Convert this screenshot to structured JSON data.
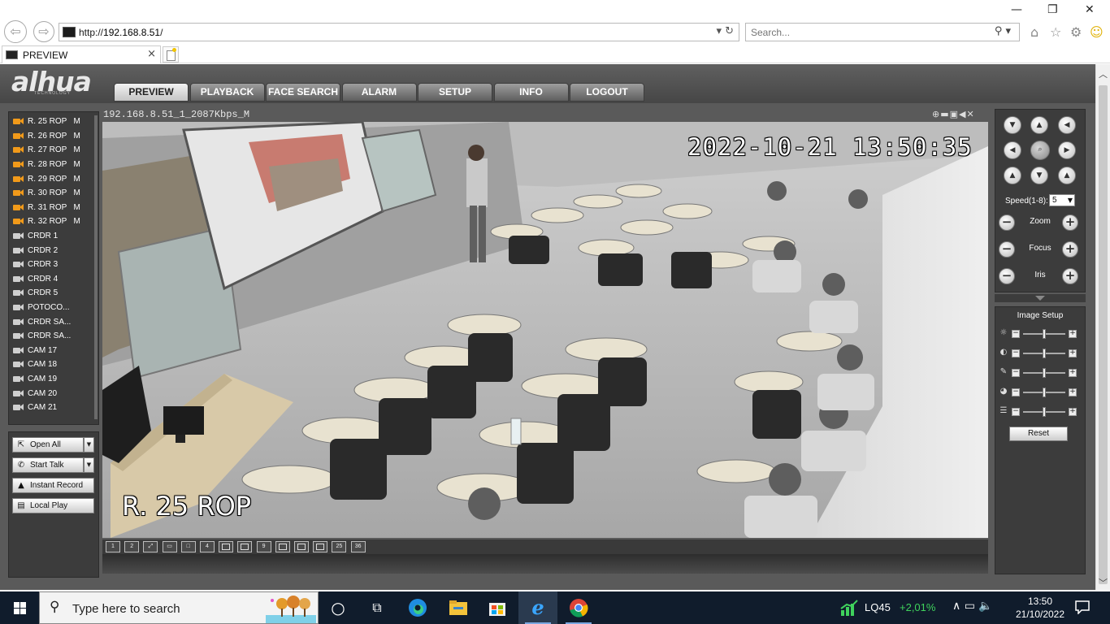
{
  "browser": {
    "back_icon": "back-arrow-icon",
    "forward_icon": "forward-arrow-icon",
    "url_prefix": "http://",
    "url_host": "192.168.8.51",
    "url_suffix": "/",
    "addr_controls": "▾ ↻",
    "search_placeholder": "Search...",
    "search_controls": "⚲ ▾",
    "tab_title": "PREVIEW",
    "tab_close": "×",
    "win_minimize": "—",
    "win_restore": "❐",
    "win_close": "✕",
    "home_glyph": "⌂",
    "fav_glyph": "☆",
    "gear_glyph": "⚙",
    "smiley_glyph": "☺"
  },
  "app": {
    "logo_text": "alhua",
    "logo_sub": "TECHNOLOGY",
    "nav": [
      {
        "label": "PREVIEW",
        "active": true
      },
      {
        "label": "PLAYBACK",
        "active": false
      },
      {
        "label": "FACE SEARCH",
        "active": false
      },
      {
        "label": "ALARM",
        "active": false
      },
      {
        "label": "SETUP",
        "active": false
      },
      {
        "label": "INFO",
        "active": false
      },
      {
        "label": "LOGOUT",
        "active": false
      }
    ]
  },
  "cameras": [
    {
      "name": "R. 25 ROP   M",
      "on": true
    },
    {
      "name": "R. 26 ROP   M",
      "on": true
    },
    {
      "name": "R. 27 ROP   M",
      "on": true
    },
    {
      "name": "R. 28 ROP   M",
      "on": true
    },
    {
      "name": "R. 29 ROP   M",
      "on": true
    },
    {
      "name": "R. 30 ROP   M",
      "on": true
    },
    {
      "name": "R. 31 ROP   M",
      "on": true
    },
    {
      "name": "R. 32 ROP   M",
      "on": true
    },
    {
      "name": "CRDR 1",
      "on": false
    },
    {
      "name": "CRDR 2",
      "on": false
    },
    {
      "name": "CRDR 3",
      "on": false
    },
    {
      "name": "CRDR 4",
      "on": false
    },
    {
      "name": "CRDR 5",
      "on": false
    },
    {
      "name": "POTOCO...",
      "on": false
    },
    {
      "name": "CRDR SA...",
      "on": false
    },
    {
      "name": "CRDR SA...",
      "on": false
    },
    {
      "name": "CAM 17",
      "on": false
    },
    {
      "name": "CAM 18",
      "on": false
    },
    {
      "name": "CAM 19",
      "on": false
    },
    {
      "name": "CAM 20",
      "on": false
    },
    {
      "name": "CAM 21",
      "on": false
    }
  ],
  "actions": {
    "open_all": "Open All",
    "start_talk": "Start Talk",
    "instant_record": "Instant Record",
    "local_play": "Local Play",
    "dropdown_glyph": "▼"
  },
  "video": {
    "stream_title": "192.168.8.51_1_2087Kbps_M",
    "window_icons": "⊕▬▣◀✕",
    "timestamp": "2022-10-21  13:50:35",
    "camera_label": "R. 25 ROP"
  },
  "layouts": [
    "1",
    "2",
    "⤢",
    "▭",
    "□",
    "4",
    "",
    "",
    "9",
    "",
    "",
    "",
    "25",
    "36"
  ],
  "ptz": {
    "speed_label": "Speed(1-8):",
    "speed_value": "5",
    "zoom_label": "Zoom",
    "focus_label": "Focus",
    "iris_label": "Iris",
    "minus": "−",
    "plus": "+"
  },
  "image_setup": {
    "title": "Image Setup",
    "reset_label": "Reset",
    "sliders": [
      {
        "icon": "brightness-icon",
        "glyph": "☼",
        "level": 0.5
      },
      {
        "icon": "contrast-icon",
        "glyph": "◐",
        "level": 0.5
      },
      {
        "icon": "saturation-icon",
        "glyph": "✎",
        "level": 0.5
      },
      {
        "icon": "hue-icon",
        "glyph": "◕",
        "level": 0.5
      },
      {
        "icon": "sharpness-icon",
        "glyph": "☰",
        "level": 0.5
      }
    ]
  },
  "taskbar": {
    "search_placeholder": "Type here to search",
    "stock_symbol": "LQ45",
    "stock_change": "+2,01%",
    "time": "13:50",
    "date": "21/10/2022",
    "tray_glyphs": "∧ ▭ 🔈"
  }
}
